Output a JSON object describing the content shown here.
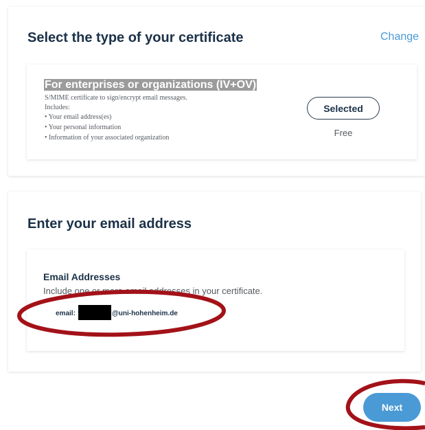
{
  "certificate_section": {
    "title": "Select the type of your certificate",
    "change_label": "Change",
    "option": {
      "title": "For enterprises or organizations (IV+OV)",
      "description": "S/MIME certificate to sign/encrypt email messages.",
      "includes_label": "Includes:",
      "includes": [
        "• Your email address(es)",
        "• Your personal information",
        "• Information of your associated organization"
      ],
      "button_label": "Selected",
      "price": "Free"
    }
  },
  "email_section": {
    "title": "Enter your email address",
    "subtitle": "Email Addresses",
    "description": "Include one or more email addresses in your certificate.",
    "email_label": "email:",
    "email_domain": "@uni-hohenheim.de"
  },
  "next_label": "Next",
  "colors": {
    "accent": "#4a9ad6",
    "heading": "#1b3148",
    "annotation": "#a31219",
    "highlight": "#9b9b9b"
  }
}
